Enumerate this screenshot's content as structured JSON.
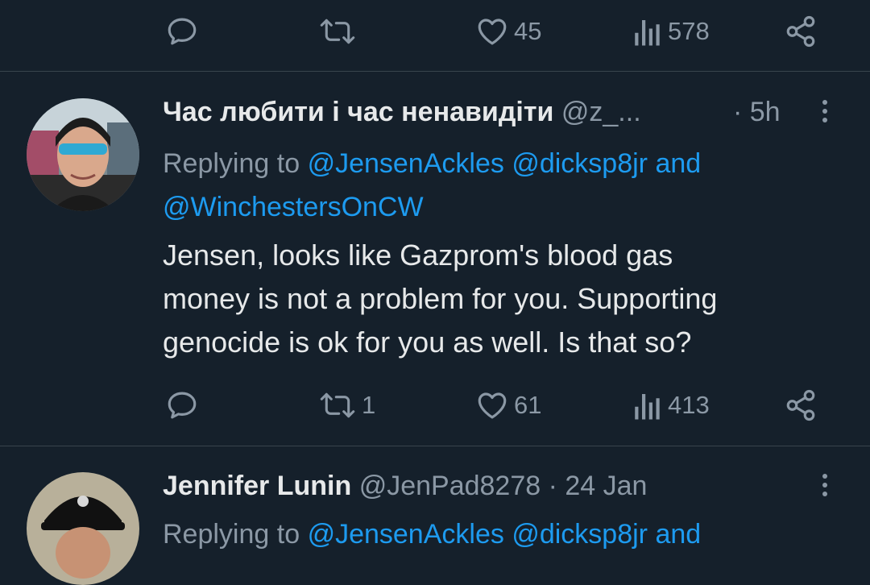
{
  "top_actions": {
    "like_count": "45",
    "views_count": "578"
  },
  "tweet1": {
    "display_name": "Час любити і час ненавидіти",
    "handle": "@z_...",
    "time": "· 5h",
    "replying_prefix": "Replying to",
    "mention1": "@JensenAckles",
    "mention2": "@dicksp8jr",
    "and_word": "and",
    "mention3": "@WinchestersOnCW",
    "text_line1": "Jensen, looks like Gazprom's blood gas",
    "text_line2": "money is not a problem for you. Supporting",
    "text_line3": "genocide is ok for you as well. Is that so?",
    "retweet_count": "1",
    "like_count": "61",
    "views_count": "413"
  },
  "tweet2": {
    "display_name": "Jennifer Lunin",
    "handle": "@JenPad8278",
    "time": "· 24 Jan",
    "replying_prefix": "Replying to",
    "mention1": "@JensenAckles",
    "mention2": "@dicksp8jr",
    "and_word": "and"
  },
  "colors": {
    "background": "#15202b",
    "text": "#e7e9ea",
    "secondary": "#8b98a5",
    "link": "#1d9bf0",
    "divider": "#38444d"
  }
}
